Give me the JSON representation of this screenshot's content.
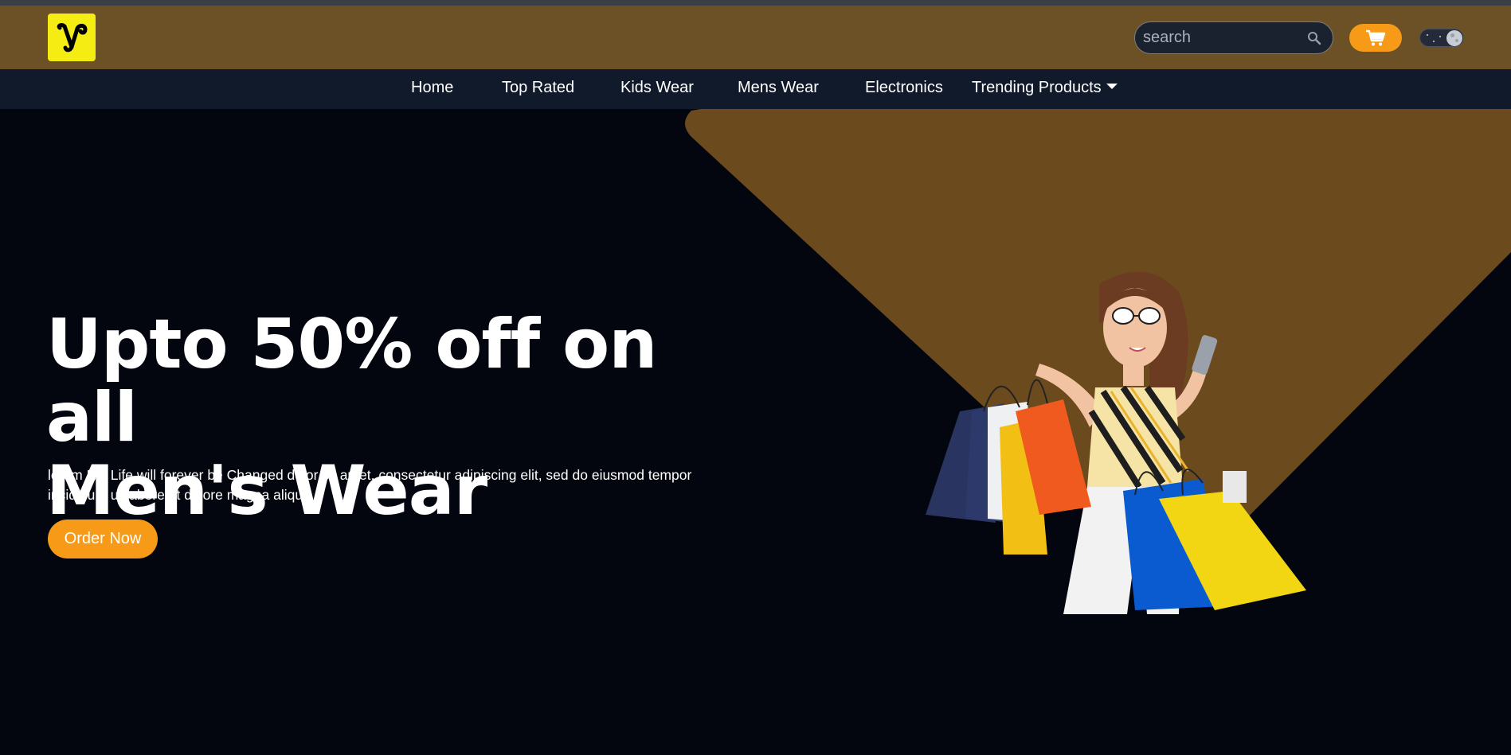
{
  "header": {
    "logo_alt": "v",
    "search": {
      "placeholder": "search"
    },
    "colors": {
      "header_bg": "#6d5126",
      "accent": "#f69a17",
      "logo_bg": "#f5ec14",
      "nav_bg": "#111a2b",
      "page_bg": "#03060f"
    }
  },
  "nav": {
    "items": [
      {
        "label": "Home"
      },
      {
        "label": "Top Rated"
      },
      {
        "label": "Kids Wear"
      },
      {
        "label": "Mens Wear"
      },
      {
        "label": "Electronics"
      },
      {
        "label": "Trending Products"
      }
    ]
  },
  "hero": {
    "headline_line1": "Upto 50% off on all",
    "headline_line2": "Men's Wear",
    "description": "lorem His Life will forever be Changed dolor sit amet, consectetur adipiscing elit, sed do eiusmod tempor incididunt ut labore et dolore magna aliqua.",
    "cta_label": "Order Now",
    "image_icon": "woman-shopping-bags-image"
  },
  "icons": {
    "search": "search-icon",
    "cart": "cart-icon",
    "theme_toggle": "dark-mode-toggle",
    "dropdown": "caret-down-icon"
  }
}
